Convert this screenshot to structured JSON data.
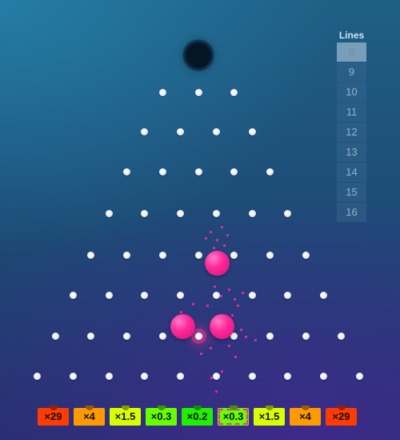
{
  "lines_panel": {
    "title": "Lines",
    "options": [
      "8",
      "9",
      "10",
      "11",
      "12",
      "13",
      "14",
      "15",
      "16"
    ],
    "selected": "8"
  },
  "board": {
    "rows": 8,
    "balls_in_play": 3
  },
  "multipliers": [
    {
      "label": "×29",
      "color": "#ff3b00"
    },
    {
      "label": "×4",
      "color": "#ff9a00"
    },
    {
      "label": "×1.5",
      "color": "#d9ff00"
    },
    {
      "label": "×0.3",
      "color": "#66ff00"
    },
    {
      "label": "×0.2",
      "color": "#22ee00"
    },
    {
      "label": "×0.3",
      "color": "#66ff00"
    },
    {
      "label": "×1.5",
      "color": "#d9ff00"
    },
    {
      "label": "×4",
      "color": "#ff9a00"
    },
    {
      "label": "×29",
      "color": "#ff3b00"
    }
  ],
  "colors": {
    "ball": "#ff2a9a",
    "peg": "#ffffff"
  },
  "icons": [
    "drop-hole",
    "ball",
    "peg"
  ]
}
